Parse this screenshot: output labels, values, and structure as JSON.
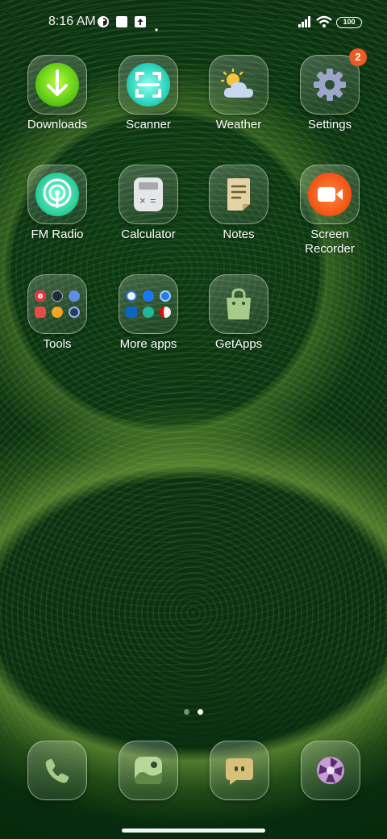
{
  "status_bar": {
    "time": "8:16 AM",
    "battery": "100",
    "icons": [
      "status-app-icon",
      "square-icon",
      "upload-icon",
      "dot-icon",
      "signal-icon",
      "wifi-icon",
      "battery-icon"
    ]
  },
  "apps": [
    {
      "label": "Downloads",
      "icon": "download-icon"
    },
    {
      "label": "Scanner",
      "icon": "scanner-icon"
    },
    {
      "label": "Weather",
      "icon": "weather-icon"
    },
    {
      "label": "Settings",
      "icon": "gear-icon",
      "badge": "2"
    },
    {
      "label": "FM Radio",
      "icon": "radio-icon"
    },
    {
      "label": "Calculator",
      "icon": "calculator-icon"
    },
    {
      "label": "Notes",
      "icon": "notes-icon"
    },
    {
      "label": "Screen\nRecorder",
      "icon": "video-camera-icon"
    },
    {
      "label": "Tools",
      "icon": "folder-icon"
    },
    {
      "label": "More apps",
      "icon": "folder-icon"
    },
    {
      "label": "GetApps",
      "icon": "shopping-bag-icon"
    }
  ],
  "page_indicator": {
    "pages": 2,
    "current": 2
  },
  "dock": [
    {
      "name": "phone",
      "icon": "phone-icon"
    },
    {
      "name": "gallery",
      "icon": "gallery-icon"
    },
    {
      "name": "messages",
      "icon": "message-icon"
    },
    {
      "name": "camera",
      "icon": "camera-aperture-icon"
    }
  ],
  "colors": {
    "wallpaper": "#0a3212",
    "badge": "#ee5a24",
    "downloads": "#6be01a",
    "scanner": "#2fe6c8",
    "radio": "#33e0b0",
    "recorder": "#ff5a1f"
  }
}
